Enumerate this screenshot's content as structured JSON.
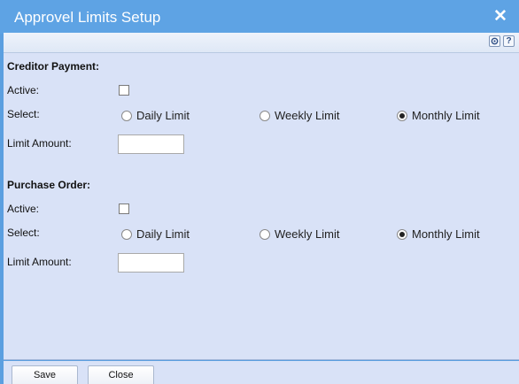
{
  "window": {
    "title": "Approvel Limits Setup",
    "close_symbol": "✕"
  },
  "toolbar": {
    "settings_icon": "gear-icon",
    "help_label": "?"
  },
  "sections": [
    {
      "title": "Creditor Payment:",
      "active_label": "Active:",
      "active_checked": false,
      "select_label": "Select:",
      "options": [
        {
          "label": "Daily Limit",
          "checked": false
        },
        {
          "label": "Weekly Limit",
          "checked": false
        },
        {
          "label": "Monthly Limit",
          "checked": true
        }
      ],
      "limit_label": "Limit Amount:",
      "limit_value": ""
    },
    {
      "title": "Purchase Order:",
      "active_label": "Active:",
      "active_checked": false,
      "select_label": "Select:",
      "options": [
        {
          "label": "Daily Limit",
          "checked": false
        },
        {
          "label": "Weekly Limit",
          "checked": false
        },
        {
          "label": "Monthly Limit",
          "checked": true
        }
      ],
      "limit_label": "Limit Amount:",
      "limit_value": ""
    }
  ],
  "buttons": {
    "save_label": "Save",
    "close_label": "Close"
  },
  "colors": {
    "titlebar": "#5ea3e4",
    "content_background": "#d9e2f7"
  }
}
